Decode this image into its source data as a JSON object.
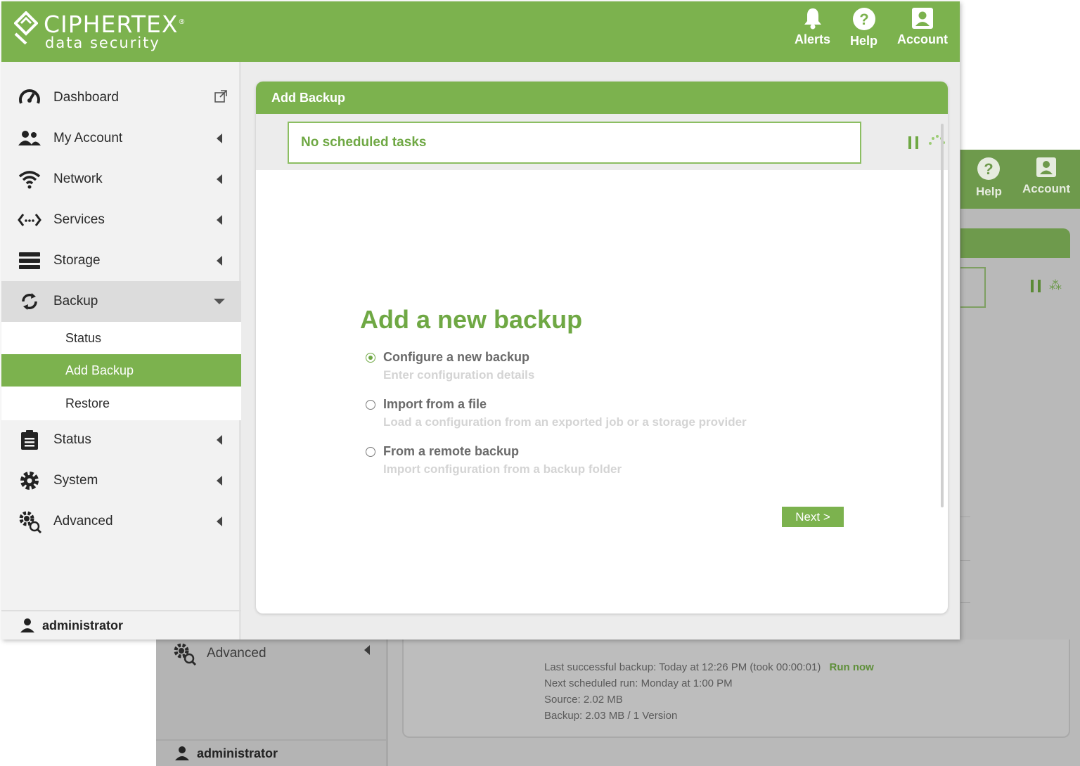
{
  "brand": {
    "name": "CIPHERTEX",
    "registered": "®",
    "tagline": "data security",
    "primary_color": "#7cb24e"
  },
  "header": {
    "buttons": [
      {
        "label": "Alerts",
        "icon": "bell-icon"
      },
      {
        "label": "Help",
        "icon": "help-icon"
      },
      {
        "label": "Account",
        "icon": "account-icon"
      }
    ]
  },
  "sidebar": {
    "items": [
      {
        "label": "Dashboard",
        "icon": "speedometer-icon",
        "trailing": "external-link-icon"
      },
      {
        "label": "My Account",
        "icon": "users-icon",
        "trailing": "collapse-arrow"
      },
      {
        "label": "Network",
        "icon": "wifi-icon",
        "trailing": "collapse-arrow"
      },
      {
        "label": "Services",
        "icon": "code-icon",
        "trailing": "collapse-arrow"
      },
      {
        "label": "Storage",
        "icon": "server-icon",
        "trailing": "collapse-arrow"
      },
      {
        "label": "Backup",
        "icon": "sync-icon",
        "trailing": "expand-caret",
        "expanded": true,
        "children": [
          {
            "label": "Status"
          },
          {
            "label": "Add Backup",
            "selected": true
          },
          {
            "label": "Restore"
          }
        ]
      },
      {
        "label": "Status",
        "icon": "clipboard-icon",
        "trailing": "collapse-arrow"
      },
      {
        "label": "System",
        "icon": "gear-icon",
        "trailing": "collapse-arrow"
      },
      {
        "label": "Advanced",
        "icon": "gears-search-icon",
        "trailing": "collapse-arrow"
      }
    ],
    "user": "administrator"
  },
  "panel": {
    "title": "Add Backup",
    "tasks_text": "No scheduled tasks",
    "wizard": {
      "heading": "Add a new backup",
      "options": [
        {
          "title": "Configure a new backup",
          "desc": "Enter configuration details",
          "selected": true
        },
        {
          "title": "Import from a file",
          "desc": "Load a configuration from an exported job or a storage provider",
          "selected": false
        },
        {
          "title": "From a remote backup",
          "desc": "Import configuration from a backup folder",
          "selected": false
        }
      ],
      "next_label": "Next >"
    }
  },
  "background_window": {
    "header_buttons": [
      {
        "label": "Help",
        "icon": "help-icon"
      },
      {
        "label": "Account",
        "icon": "account-icon"
      }
    ],
    "sidebar_item": "Advanced",
    "user": "administrator",
    "stats": {
      "last_label": "Last successful backup:",
      "last_value": "Today at 12:26 PM (took 00:00:01)",
      "run_now": "Run now",
      "next_label": "Next scheduled run:",
      "next_value": "Monday at 1:00 PM",
      "source_label": "Source:",
      "source_value": "2.02 MB",
      "backup_label": "Backup:",
      "backup_value": "2.03 MB / 1 Version"
    }
  }
}
